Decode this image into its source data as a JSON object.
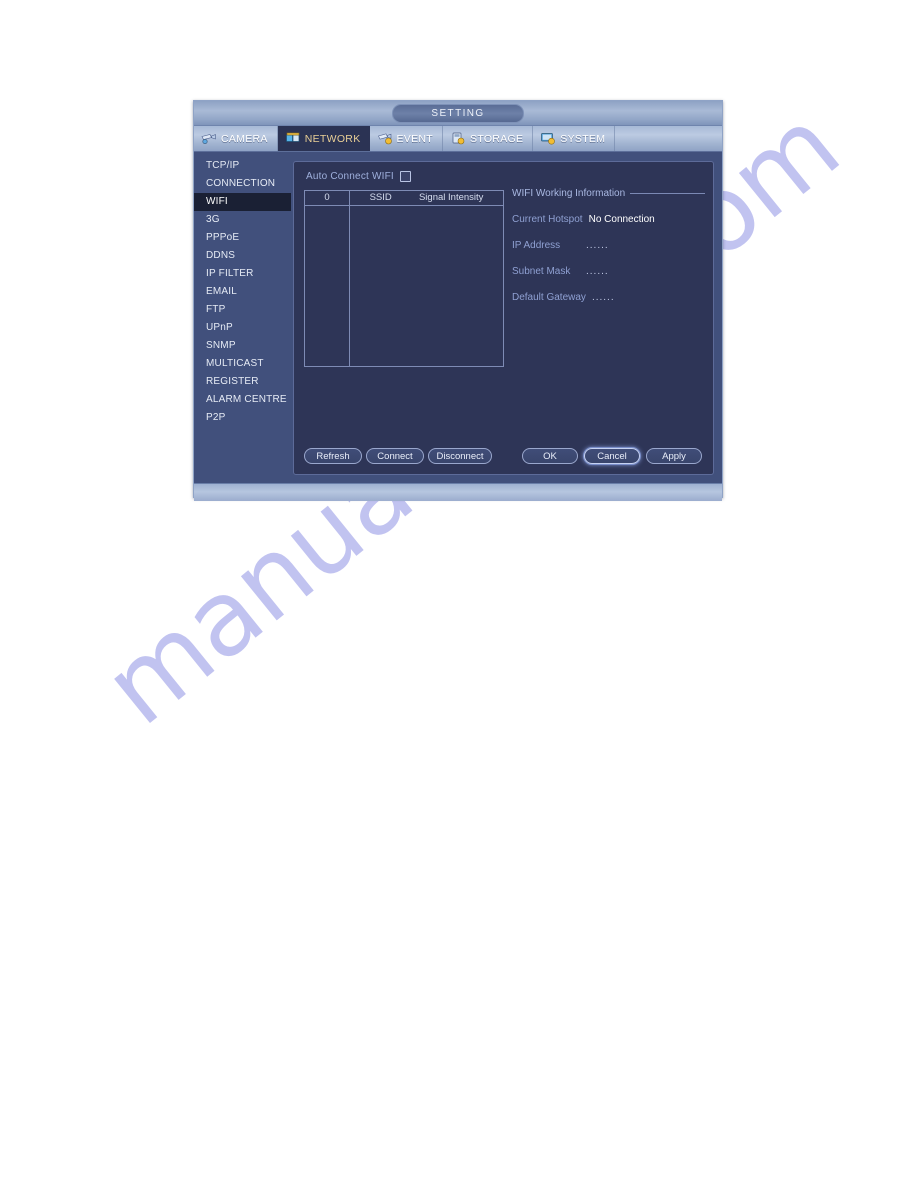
{
  "watermark": {
    "text": "manualshive.com"
  },
  "window": {
    "title": "SETTING",
    "tabs": [
      {
        "label": "CAMERA",
        "icon": "camera-icon",
        "active": false
      },
      {
        "label": "NETWORK",
        "icon": "network-icon",
        "active": true
      },
      {
        "label": "EVENT",
        "icon": "event-icon",
        "active": false
      },
      {
        "label": "STORAGE",
        "icon": "storage-icon",
        "active": false
      },
      {
        "label": "SYSTEM",
        "icon": "system-icon",
        "active": false
      }
    ],
    "sidebar": {
      "items": [
        {
          "label": "TCP/IP",
          "active": false
        },
        {
          "label": "CONNECTION",
          "active": false
        },
        {
          "label": "WIFI",
          "active": true
        },
        {
          "label": "3G",
          "active": false
        },
        {
          "label": "PPPoE",
          "active": false
        },
        {
          "label": "DDNS",
          "active": false
        },
        {
          "label": "IP FILTER",
          "active": false
        },
        {
          "label": "EMAIL",
          "active": false
        },
        {
          "label": "FTP",
          "active": false
        },
        {
          "label": "UPnP",
          "active": false
        },
        {
          "label": "SNMP",
          "active": false
        },
        {
          "label": "MULTICAST",
          "active": false
        },
        {
          "label": "REGISTER",
          "active": false
        },
        {
          "label": "ALARM CENTRE",
          "active": false
        },
        {
          "label": "P2P",
          "active": false
        }
      ]
    },
    "main": {
      "auto_connect": {
        "label": "Auto Connect WIFI",
        "checked": false
      },
      "wifi_table": {
        "columns": [
          "0",
          "SSID",
          "Signal Intensity"
        ],
        "rows": []
      },
      "info": {
        "title": "WIFI Working Information",
        "rows": [
          {
            "key": "Current Hotspot",
            "value": "No Connection",
            "dots": false
          },
          {
            "key": "IP Address",
            "value": "......",
            "dots": true
          },
          {
            "key": "Subnet Mask",
            "value": "......",
            "dots": true
          },
          {
            "key": "Default Gateway",
            "value": "......",
            "dots": true
          }
        ]
      }
    },
    "buttons": {
      "left": [
        {
          "label": "Refresh",
          "focused": false
        },
        {
          "label": "Connect",
          "focused": false
        },
        {
          "label": "Disconnect",
          "focused": false
        }
      ],
      "right": [
        {
          "label": "OK",
          "focused": false
        },
        {
          "label": "Cancel",
          "focused": true
        },
        {
          "label": "Apply",
          "focused": false
        }
      ]
    }
  },
  "colors": {
    "window_bg": "#2b3354",
    "panel_bg": "#2e3557",
    "sidebar_bg": "#41507c",
    "active_tab_text": "#e9cf96",
    "label_blue": "#8fa0d2",
    "titlebar": "#a9bad6",
    "watermark": "#b7b9ee"
  }
}
